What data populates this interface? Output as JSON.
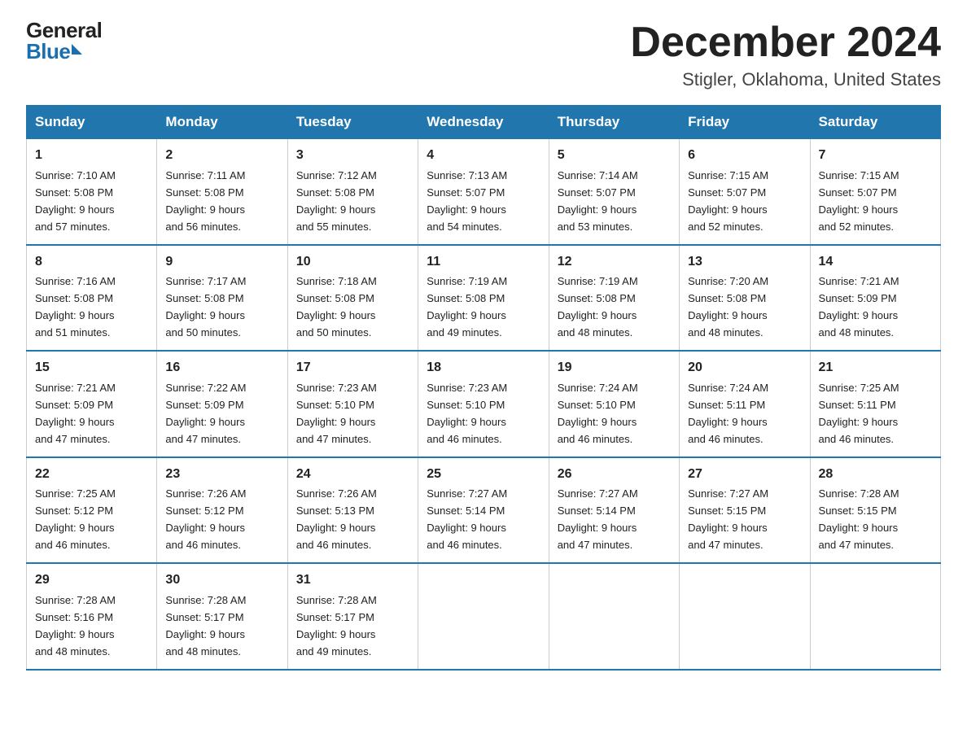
{
  "logo": {
    "general": "General",
    "blue": "Blue"
  },
  "title": "December 2024",
  "subtitle": "Stigler, Oklahoma, United States",
  "days_of_week": [
    "Sunday",
    "Monday",
    "Tuesday",
    "Wednesday",
    "Thursday",
    "Friday",
    "Saturday"
  ],
  "weeks": [
    [
      {
        "day": "1",
        "sunrise": "7:10 AM",
        "sunset": "5:08 PM",
        "daylight": "9 hours and 57 minutes."
      },
      {
        "day": "2",
        "sunrise": "7:11 AM",
        "sunset": "5:08 PM",
        "daylight": "9 hours and 56 minutes."
      },
      {
        "day": "3",
        "sunrise": "7:12 AM",
        "sunset": "5:08 PM",
        "daylight": "9 hours and 55 minutes."
      },
      {
        "day": "4",
        "sunrise": "7:13 AM",
        "sunset": "5:07 PM",
        "daylight": "9 hours and 54 minutes."
      },
      {
        "day": "5",
        "sunrise": "7:14 AM",
        "sunset": "5:07 PM",
        "daylight": "9 hours and 53 minutes."
      },
      {
        "day": "6",
        "sunrise": "7:15 AM",
        "sunset": "5:07 PM",
        "daylight": "9 hours and 52 minutes."
      },
      {
        "day": "7",
        "sunrise": "7:15 AM",
        "sunset": "5:07 PM",
        "daylight": "9 hours and 52 minutes."
      }
    ],
    [
      {
        "day": "8",
        "sunrise": "7:16 AM",
        "sunset": "5:08 PM",
        "daylight": "9 hours and 51 minutes."
      },
      {
        "day": "9",
        "sunrise": "7:17 AM",
        "sunset": "5:08 PM",
        "daylight": "9 hours and 50 minutes."
      },
      {
        "day": "10",
        "sunrise": "7:18 AM",
        "sunset": "5:08 PM",
        "daylight": "9 hours and 50 minutes."
      },
      {
        "day": "11",
        "sunrise": "7:19 AM",
        "sunset": "5:08 PM",
        "daylight": "9 hours and 49 minutes."
      },
      {
        "day": "12",
        "sunrise": "7:19 AM",
        "sunset": "5:08 PM",
        "daylight": "9 hours and 48 minutes."
      },
      {
        "day": "13",
        "sunrise": "7:20 AM",
        "sunset": "5:08 PM",
        "daylight": "9 hours and 48 minutes."
      },
      {
        "day": "14",
        "sunrise": "7:21 AM",
        "sunset": "5:09 PM",
        "daylight": "9 hours and 48 minutes."
      }
    ],
    [
      {
        "day": "15",
        "sunrise": "7:21 AM",
        "sunset": "5:09 PM",
        "daylight": "9 hours and 47 minutes."
      },
      {
        "day": "16",
        "sunrise": "7:22 AM",
        "sunset": "5:09 PM",
        "daylight": "9 hours and 47 minutes."
      },
      {
        "day": "17",
        "sunrise": "7:23 AM",
        "sunset": "5:10 PM",
        "daylight": "9 hours and 47 minutes."
      },
      {
        "day": "18",
        "sunrise": "7:23 AM",
        "sunset": "5:10 PM",
        "daylight": "9 hours and 46 minutes."
      },
      {
        "day": "19",
        "sunrise": "7:24 AM",
        "sunset": "5:10 PM",
        "daylight": "9 hours and 46 minutes."
      },
      {
        "day": "20",
        "sunrise": "7:24 AM",
        "sunset": "5:11 PM",
        "daylight": "9 hours and 46 minutes."
      },
      {
        "day": "21",
        "sunrise": "7:25 AM",
        "sunset": "5:11 PM",
        "daylight": "9 hours and 46 minutes."
      }
    ],
    [
      {
        "day": "22",
        "sunrise": "7:25 AM",
        "sunset": "5:12 PM",
        "daylight": "9 hours and 46 minutes."
      },
      {
        "day": "23",
        "sunrise": "7:26 AM",
        "sunset": "5:12 PM",
        "daylight": "9 hours and 46 minutes."
      },
      {
        "day": "24",
        "sunrise": "7:26 AM",
        "sunset": "5:13 PM",
        "daylight": "9 hours and 46 minutes."
      },
      {
        "day": "25",
        "sunrise": "7:27 AM",
        "sunset": "5:14 PM",
        "daylight": "9 hours and 46 minutes."
      },
      {
        "day": "26",
        "sunrise": "7:27 AM",
        "sunset": "5:14 PM",
        "daylight": "9 hours and 47 minutes."
      },
      {
        "day": "27",
        "sunrise": "7:27 AM",
        "sunset": "5:15 PM",
        "daylight": "9 hours and 47 minutes."
      },
      {
        "day": "28",
        "sunrise": "7:28 AM",
        "sunset": "5:15 PM",
        "daylight": "9 hours and 47 minutes."
      }
    ],
    [
      {
        "day": "29",
        "sunrise": "7:28 AM",
        "sunset": "5:16 PM",
        "daylight": "9 hours and 48 minutes."
      },
      {
        "day": "30",
        "sunrise": "7:28 AM",
        "sunset": "5:17 PM",
        "daylight": "9 hours and 48 minutes."
      },
      {
        "day": "31",
        "sunrise": "7:28 AM",
        "sunset": "5:17 PM",
        "daylight": "9 hours and 49 minutes."
      },
      null,
      null,
      null,
      null
    ]
  ],
  "labels": {
    "sunrise": "Sunrise:",
    "sunset": "Sunset:",
    "daylight": "Daylight:"
  }
}
